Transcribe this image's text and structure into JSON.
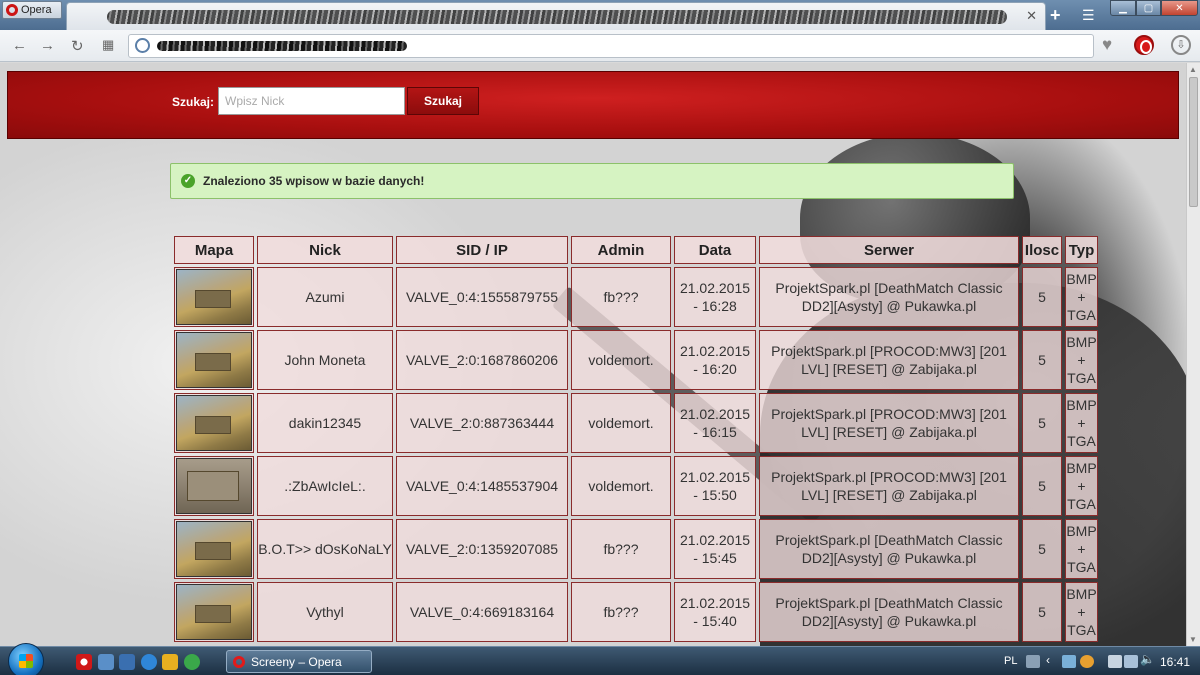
{
  "browser": {
    "menu_label": "Opera",
    "tab_close": "✕",
    "new_tab": "+",
    "download_glyph": "⇩"
  },
  "search": {
    "label": "Szukaj:",
    "placeholder": "Wpisz Nick",
    "button": "Szukaj"
  },
  "alert": {
    "message": "Znaleziono 35 wpisow w bazie danych!"
  },
  "table": {
    "headers": [
      "Mapa",
      "Nick",
      "SID / IP",
      "Admin",
      "Data",
      "Serwer",
      "Ilosc",
      "Typ"
    ],
    "rows": [
      {
        "nick": "Azumi",
        "sid": "VALVE_0:4:1555879755",
        "admin": "fb???",
        "date1": "21.02.2015",
        "date2": "- 16:28",
        "srv1": "ProjektSpark.pl [DeathMatch Classic",
        "srv2": "DD2][Asysty] @ Pukawka.pl",
        "ilosc": "5",
        "typ1": "BMP",
        "typ2": "+",
        "typ3": "TGA"
      },
      {
        "nick": "John Moneta",
        "sid": "VALVE_2:0:1687860206",
        "admin": "voldemort.",
        "date1": "21.02.2015",
        "date2": "- 16:20",
        "srv1": "ProjektSpark.pl [PROCOD:MW3] [201",
        "srv2": "LVL] [RESET] @ Zabijaka.pl",
        "ilosc": "5",
        "typ1": "BMP",
        "typ2": "+",
        "typ3": "TGA"
      },
      {
        "nick": "dakin12345",
        "sid": "VALVE_2:0:887363444",
        "admin": "voldemort.",
        "date1": "21.02.2015",
        "date2": "- 16:15",
        "srv1": "ProjektSpark.pl [PROCOD:MW3] [201",
        "srv2": "LVL] [RESET] @ Zabijaka.pl",
        "ilosc": "5",
        "typ1": "BMP",
        "typ2": "+",
        "typ3": "TGA"
      },
      {
        "nick": ".:ZbAwIcIeL:.",
        "sid": "VALVE_0:4:1485537904",
        "admin": "voldemort.",
        "date1": "21.02.2015",
        "date2": "- 15:50",
        "srv1": "ProjektSpark.pl [PROCOD:MW3] [201",
        "srv2": "LVL] [RESET] @ Zabijaka.pl",
        "ilosc": "5",
        "typ1": "BMP",
        "typ2": "+",
        "typ3": "TGA"
      },
      {
        "nick": "B.O.T>> dOsKoNaLY",
        "sid": "VALVE_2:0:1359207085",
        "admin": "fb???",
        "date1": "21.02.2015",
        "date2": "- 15:45",
        "srv1": "ProjektSpark.pl [DeathMatch Classic",
        "srv2": "DD2][Asysty] @ Pukawka.pl",
        "ilosc": "5",
        "typ1": "BMP",
        "typ2": "+",
        "typ3": "TGA"
      },
      {
        "nick": "Vythyl",
        "sid": "VALVE_0:4:669183164",
        "admin": "fb???",
        "date1": "21.02.2015",
        "date2": "- 15:40",
        "srv1": "ProjektSpark.pl [DeathMatch Classic",
        "srv2": "DD2][Asysty] @ Pukawka.pl",
        "ilosc": "5",
        "typ1": "BMP",
        "typ2": "+",
        "typ3": "TGA"
      }
    ]
  },
  "taskbar": {
    "window_label": "Screeny – Opera",
    "lang": "PL",
    "clock": "16:41"
  },
  "colors": {
    "banner_red": "#b01010",
    "alert_green": "#d6f3c2",
    "cell_bg": "#f0dcdc",
    "cell_border": "#8a2b2b"
  }
}
